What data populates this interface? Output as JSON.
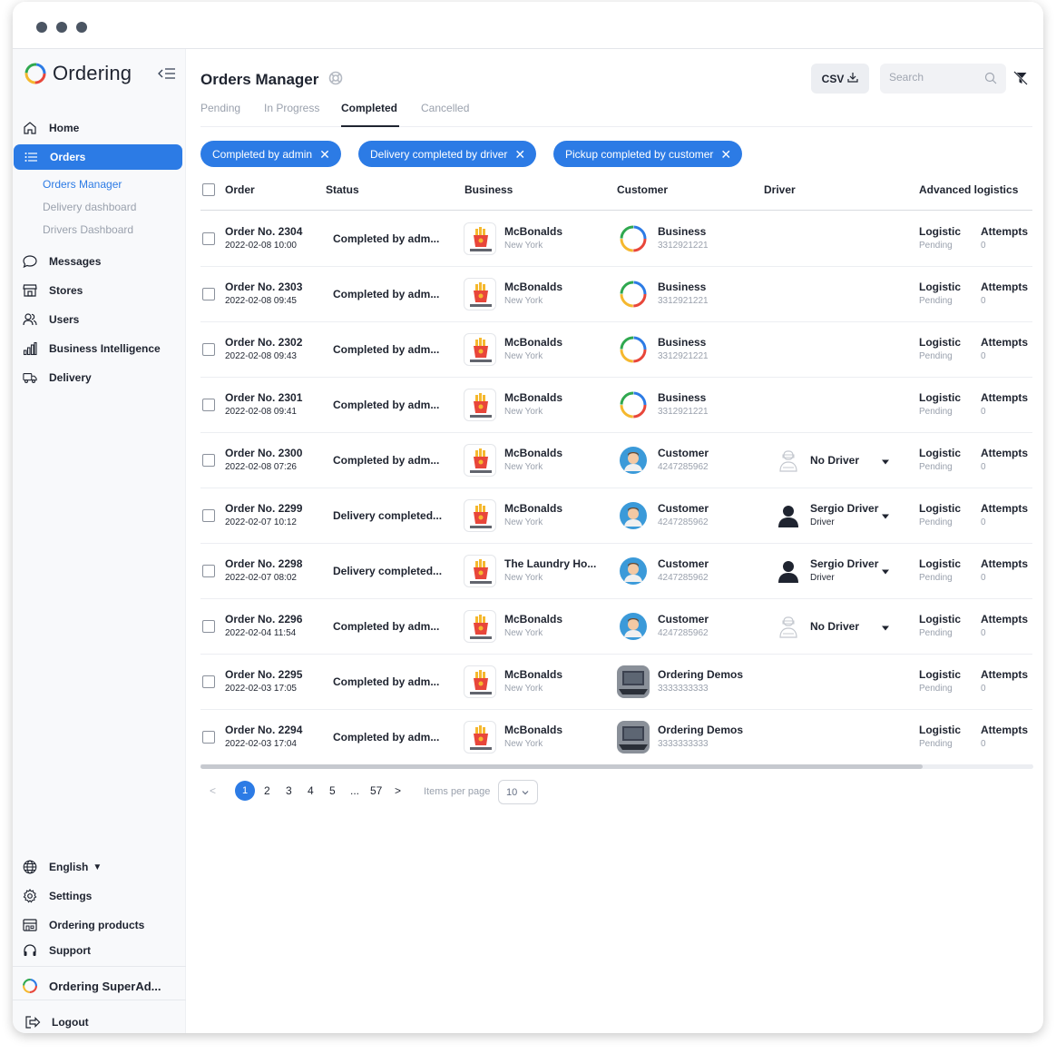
{
  "sidebar": {
    "brand": "Ordering",
    "nav": [
      {
        "label": "Home",
        "icon": "home-icon"
      },
      {
        "label": "Orders",
        "icon": "list-icon"
      },
      {
        "label": "Messages",
        "icon": "chat-icon"
      },
      {
        "label": "Stores",
        "icon": "store-icon"
      },
      {
        "label": "Users",
        "icon": "users-icon"
      },
      {
        "label": "Business Intelligence",
        "icon": "bar-chart-icon"
      },
      {
        "label": "Delivery",
        "icon": "truck-icon"
      }
    ],
    "orders_sub": [
      "Orders Manager",
      "Delivery dashboard",
      "Drivers Dashboard"
    ],
    "language": "English",
    "settings": "Settings",
    "ordering_products": "Ordering products",
    "support": "Support",
    "account": "Ordering SuperAd...",
    "logout": "Logout"
  },
  "header": {
    "title": "Orders Manager",
    "csv_label": "CSV",
    "search_placeholder": "Search"
  },
  "tabs": [
    "Pending",
    "In Progress",
    "Completed",
    "Cancelled"
  ],
  "active_tab": "Completed",
  "filters": [
    "Completed by admin",
    "Delivery completed by driver",
    "Pickup completed by customer"
  ],
  "columns": [
    "Order",
    "Status",
    "Business",
    "Customer",
    "Driver",
    "Advanced logistics"
  ],
  "orders": [
    {
      "number": "Order No. 2304",
      "date": "2022-02-08 10:00",
      "status": "Completed by adm...",
      "business": "McBonalds",
      "business_city": "New York",
      "customer": "Business",
      "customer_phone": "3312921221",
      "driver": "",
      "driver_role": "",
      "logistic": "Logistic",
      "logistic_status": "Pending",
      "attempts_label": "Attempts",
      "attempts": "0"
    },
    {
      "number": "Order No. 2303",
      "date": "2022-02-08 09:45",
      "status": "Completed by adm...",
      "business": "McBonalds",
      "business_city": "New York",
      "customer": "Business",
      "customer_phone": "3312921221",
      "driver": "",
      "driver_role": "",
      "logistic": "Logistic",
      "logistic_status": "Pending",
      "attempts_label": "Attempts",
      "attempts": "0"
    },
    {
      "number": "Order No. 2302",
      "date": "2022-02-08 09:43",
      "status": "Completed by adm...",
      "business": "McBonalds",
      "business_city": "New York",
      "customer": "Business",
      "customer_phone": "3312921221",
      "driver": "",
      "driver_role": "",
      "logistic": "Logistic",
      "logistic_status": "Pending",
      "attempts_label": "Attempts",
      "attempts": "0"
    },
    {
      "number": "Order No. 2301",
      "date": "2022-02-08 09:41",
      "status": "Completed by adm...",
      "business": "McBonalds",
      "business_city": "New York",
      "customer": "Business",
      "customer_phone": "3312921221",
      "driver": "",
      "driver_role": "",
      "logistic": "Logistic",
      "logistic_status": "Pending",
      "attempts_label": "Attempts",
      "attempts": "0"
    },
    {
      "number": "Order No. 2300",
      "date": "2022-02-08 07:26",
      "status": "Completed by adm...",
      "business": "McBonalds",
      "business_city": "New York",
      "customer": "Customer",
      "customer_phone": "4247285962",
      "driver": "No Driver",
      "driver_role": "",
      "logistic": "Logistic",
      "logistic_status": "Pending",
      "attempts_label": "Attempts",
      "attempts": "0"
    },
    {
      "number": "Order No. 2299",
      "date": "2022-02-07 10:12",
      "status": "Delivery completed...",
      "business": "McBonalds",
      "business_city": "New York",
      "customer": "Customer",
      "customer_phone": "4247285962",
      "driver": "Sergio Driver",
      "driver_role": "Driver",
      "logistic": "Logistic",
      "logistic_status": "Pending",
      "attempts_label": "Attempts",
      "attempts": "0"
    },
    {
      "number": "Order No. 2298",
      "date": "2022-02-07 08:02",
      "status": "Delivery completed...",
      "business": "The Laundry Ho...",
      "business_city": "New York",
      "customer": "Customer",
      "customer_phone": "4247285962",
      "driver": "Sergio Driver",
      "driver_role": "Driver",
      "logistic": "Logistic",
      "logistic_status": "Pending",
      "attempts_label": "Attempts",
      "attempts": "0"
    },
    {
      "number": "Order No. 2296",
      "date": "2022-02-04 11:54",
      "status": "Completed by adm...",
      "business": "McBonalds",
      "business_city": "New York",
      "customer": "Customer",
      "customer_phone": "4247285962",
      "driver": "No Driver",
      "driver_role": "",
      "logistic": "Logistic",
      "logistic_status": "Pending",
      "attempts_label": "Attempts",
      "attempts": "0"
    },
    {
      "number": "Order No. 2295",
      "date": "2022-02-03 17:05",
      "status": "Completed by adm...",
      "business": "McBonalds",
      "business_city": "New York",
      "customer": "Ordering Demos",
      "customer_phone": "3333333333",
      "driver": "",
      "driver_role": "",
      "logistic": "Logistic",
      "logistic_status": "Pending",
      "attempts_label": "Attempts",
      "attempts": "0"
    },
    {
      "number": "Order No. 2294",
      "date": "2022-02-03 17:04",
      "status": "Completed by adm...",
      "business": "McBonalds",
      "business_city": "New York",
      "customer": "Ordering Demos",
      "customer_phone": "3333333333",
      "driver": "",
      "driver_role": "",
      "logistic": "Logistic",
      "logistic_status": "Pending",
      "attempts_label": "Attempts",
      "attempts": "0"
    }
  ],
  "pagination": {
    "prev": "<",
    "pages": [
      "1",
      "2",
      "3",
      "4",
      "5",
      "...",
      "57"
    ],
    "current": "1",
    "next": ">",
    "items_per_page_label": "Items per page",
    "items_per_page": "10"
  },
  "colors": {
    "accent": "#2c7be5",
    "text": "#1f2430",
    "muted": "#9aa1ad"
  }
}
